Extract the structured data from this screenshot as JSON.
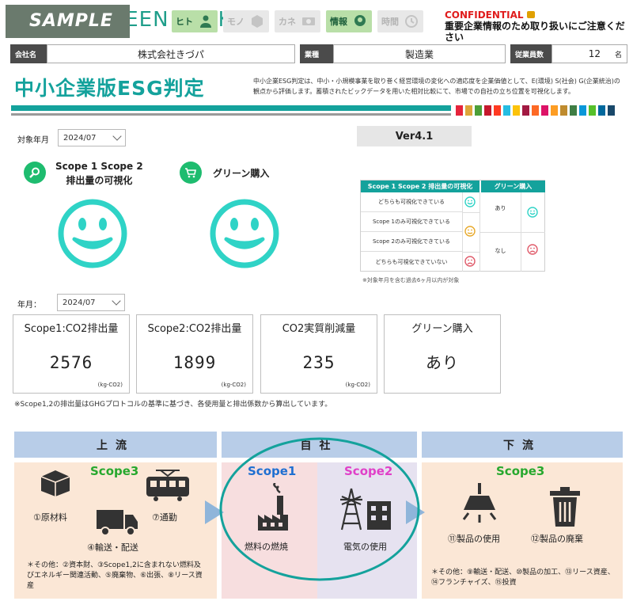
{
  "header": {
    "watermark": "SAMPLE",
    "brand": "GREEN PARK",
    "tabs": [
      {
        "label": "ヒト",
        "active": true
      },
      {
        "label": "モノ",
        "active": false
      },
      {
        "label": "カネ",
        "active": false
      },
      {
        "label": "情報",
        "active": true
      },
      {
        "label": "時間",
        "active": false
      }
    ],
    "confidential": "CONFIDENTIAL",
    "confidential_note": "重要企業情報のため取り扱いにご注意ください"
  },
  "company": {
    "name_label": "会社名",
    "name": "株式会社きづパ",
    "industry_label": "業種",
    "industry": "製造業",
    "employees_label": "従業員数",
    "employees": "12",
    "employees_unit": "名"
  },
  "title": "中小企業版ESG判定",
  "description": "中小企業ESG判定は、中小・小規模事業を取り巻く経営環境の変化への適応度を企業価値として、E(環境) S(社会) G(企業統治)の観点から評価します。蓄積されたビックデータを用いた相対比較にて、市場での自社の立ち位置を可視化します。",
  "colors": {
    "teal": "#14a29c",
    "smile": "#2fd3c6",
    "scope1": "#1f6fd1",
    "scope2": "#e040c8",
    "scope3": "#27a82e",
    "upstream": "#fbe7d6",
    "own1": "#f7dedf",
    "own2": "#e6e2f0",
    "head": "#b8cde8"
  },
  "filter": {
    "label": "対象年月",
    "value": "2024/07"
  },
  "version": "Ver4.1",
  "status": {
    "scope_title1": "Scope 1 Scope 2",
    "scope_title2": "排出量の可視化",
    "green_title": "グリーン購入",
    "scope_icon": "search-icon",
    "green_icon": "cart-icon"
  },
  "legend": {
    "col1": "Scope 1 Scope 2 排出量の可視化",
    "col2": "グリーン購入",
    "rows": [
      "どちらも可視化できている",
      "Scope 1のみ可視化できている",
      "Scope 2のみ可視化できている",
      "どちらも可視化できていない"
    ],
    "green": [
      "あり",
      "なし"
    ],
    "note": "※対象年月を含む過去6ヶ月以内が対象"
  },
  "period": {
    "label": "年月：",
    "value": "2024/07"
  },
  "metrics": [
    {
      "title": "Scope1:CO2排出量",
      "value": "2576",
      "unit": "(kg-CO2)"
    },
    {
      "title": "Scope2:CO2排出量",
      "value": "1899",
      "unit": "(kg-CO2)"
    },
    {
      "title": "CO2実質削減量",
      "value": "235",
      "unit": "(kg-CO2)"
    },
    {
      "title": "グリーン購入",
      "value": "あり",
      "unit": ""
    }
  ],
  "metrics_note": "※Scope1,2の排出量はGHGプロトコルの基準に基づき、各使用量と排出係数から算出しています。",
  "flow": {
    "upstream": {
      "head": "上流",
      "scope": "Scope3",
      "items": [
        "①原材料",
        "⑦通勤",
        "④輸送・配送"
      ],
      "note": "＊その他：②資本財、③Scope1,2に含まれない燃料及びエネルギー関連活動、⑤廃棄物、⑥出張、⑧リース資産"
    },
    "own": {
      "head": "自社",
      "scope1": "Scope1",
      "scope1_item": "燃料の燃焼",
      "scope2": "Scope2",
      "scope2_item": "電気の使用"
    },
    "downstream": {
      "head": "下流",
      "scope": "Scope3",
      "items": [
        "⑪製品の使用",
        "⑫製品の廃棄"
      ],
      "note": "＊その他：⑨輸送・配送、⑩製品の加工、⑬リース資産、⑭フランチャイズ、⑮投資"
    }
  }
}
